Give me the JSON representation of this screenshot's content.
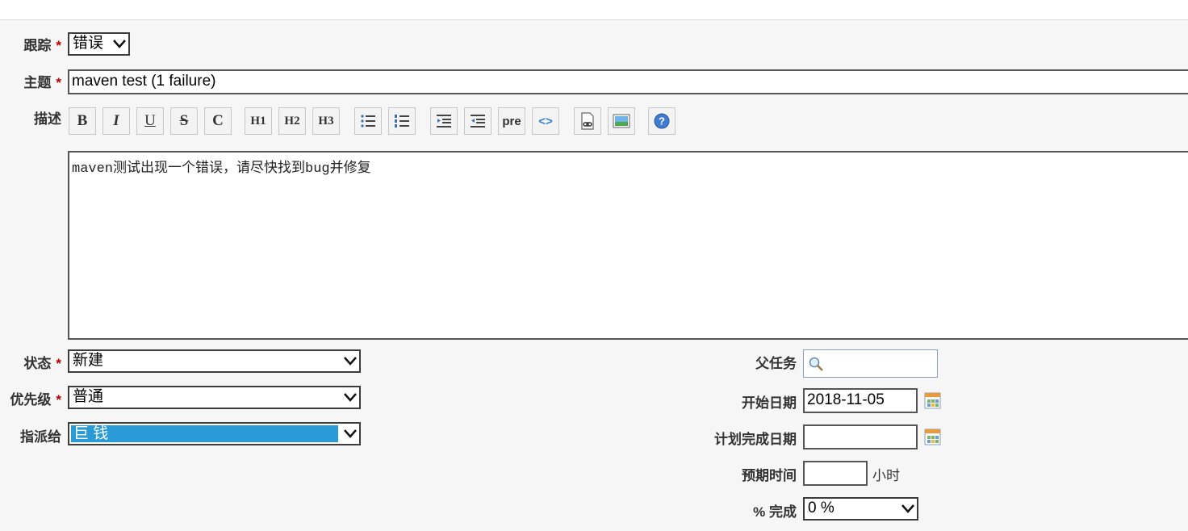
{
  "form": {
    "tracker": {
      "label": "跟踪",
      "required": "*",
      "value": "错误"
    },
    "subject": {
      "label": "主题",
      "required": "*",
      "value": "maven test  (1 failure)"
    },
    "description": {
      "label": "描述",
      "value": "maven测试出现一个错误，请尽快找到bug并修复",
      "toolbar": [
        "B",
        "I",
        "U",
        "S",
        "C",
        "H1",
        "H2",
        "H3",
        "ul",
        "ol",
        "indent",
        "outdent",
        "pre",
        "<>",
        "link",
        "image",
        "help"
      ]
    },
    "status": {
      "label": "状态",
      "required": "*",
      "value": "新建"
    },
    "priority": {
      "label": "优先级",
      "required": "*",
      "value": "普通"
    },
    "assignee": {
      "label": "指派给",
      "value": "巨 钱"
    },
    "parent_task": {
      "label": "父任务",
      "value": ""
    },
    "start_date": {
      "label": "开始日期",
      "value": "2018-11-05"
    },
    "due_date": {
      "label": "计划完成日期",
      "value": ""
    },
    "estimated_time": {
      "label": "预期时间",
      "value": "",
      "unit": "小时"
    },
    "done_ratio": {
      "label": "% 完成",
      "value": "0 %"
    }
  },
  "toolbar_labels": {
    "pre": "pre",
    "code": "<>",
    "h1": "H1",
    "h2": "H2",
    "h3": "H3",
    "bold": "B",
    "italic": "I",
    "underline": "U",
    "strike": "S",
    "inline_code": "C"
  },
  "colors": {
    "assignee_highlight": "#2a9bd6",
    "required": "#bb0000"
  }
}
